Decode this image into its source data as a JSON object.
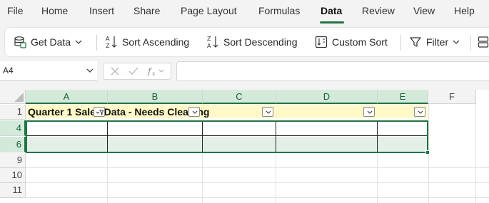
{
  "menu": {
    "tabs": [
      "File",
      "Home",
      "Insert",
      "Share",
      "Page Layout",
      "Formulas",
      "Data",
      "Review",
      "View",
      "Help"
    ],
    "active": "Data"
  },
  "ribbon": {
    "get_data": "Get Data",
    "sort_asc": "Sort Ascending",
    "sort_desc": "Sort Descending",
    "custom_sort": "Custom Sort",
    "filter": "Filter"
  },
  "formula_bar": {
    "name_box": "A4",
    "formula": ""
  },
  "grid": {
    "columns": [
      "A",
      "B",
      "C",
      "D",
      "E",
      "F"
    ],
    "selected_columns": [
      "A",
      "B",
      "C",
      "D",
      "E"
    ],
    "rows": [
      "1",
      "4",
      "6",
      "9",
      "10",
      "11"
    ],
    "selected_rows": [
      "4",
      "6"
    ],
    "cell_a1": "Quarter 1 Sales Data - Needs Cleaning"
  },
  "colors": {
    "accent": "#217346",
    "header_fill": "#fff9c7",
    "selection_fill": "#d3eadb"
  }
}
